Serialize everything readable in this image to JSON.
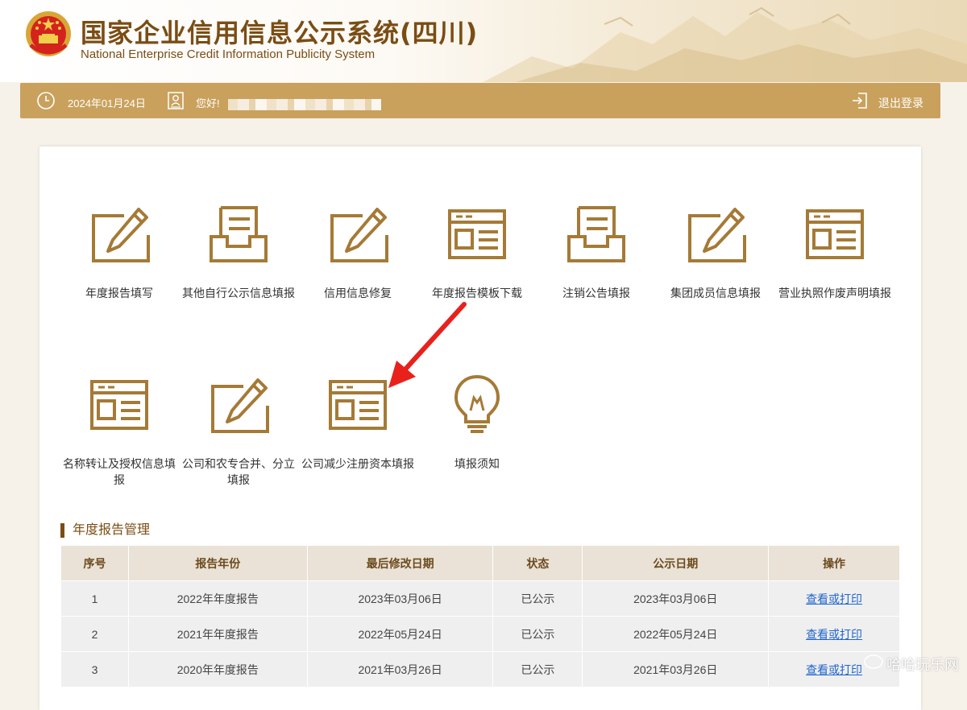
{
  "header": {
    "title": "国家企业信用信息公示系统(四川)",
    "subtitle": "National Enterprise Credit Information Publicity System"
  },
  "userbar": {
    "date": "2024年01月24日",
    "greeting": "您好!",
    "logout": "退出登录"
  },
  "tiles": [
    {
      "label": "年度报告填写",
      "icon": "pencil-edit-icon"
    },
    {
      "label": "其他自行公示信息填报",
      "icon": "document-tray-icon"
    },
    {
      "label": "信用信息修复",
      "icon": "pencil-edit-icon"
    },
    {
      "label": "年度报告模板下载",
      "icon": "form-template-icon"
    },
    {
      "label": "注销公告填报",
      "icon": "document-tray-icon"
    },
    {
      "label": "集团成员信息填报",
      "icon": "pencil-edit-icon"
    },
    {
      "label": "营业执照作废声明填报",
      "icon": "form-template-icon"
    },
    {
      "label": "名称转让及授权信息填报",
      "icon": "form-template-icon"
    },
    {
      "label": "公司和农专合并、分立填报",
      "icon": "pencil-edit-icon"
    },
    {
      "label": "公司减少注册资本填报",
      "icon": "form-template-icon"
    },
    {
      "label": "填报须知",
      "icon": "lightbulb-icon"
    }
  ],
  "reports": {
    "section_title": "年度报告管理",
    "columns": [
      "序号",
      "报告年份",
      "最后修改日期",
      "状态",
      "公示日期",
      "操作"
    ],
    "rows": [
      {
        "no": "1",
        "year": "2022年年度报告",
        "modified": "2023年03月06日",
        "status": "已公示",
        "published": "2023年03月06日",
        "action": "查看或打印"
      },
      {
        "no": "2",
        "year": "2021年年度报告",
        "modified": "2022年05月24日",
        "status": "已公示",
        "published": "2022年05月24日",
        "action": "查看或打印"
      },
      {
        "no": "3",
        "year": "2020年年度报告",
        "modified": "2021年03月26日",
        "status": "已公示",
        "published": "2021年03月26日",
        "action": "查看或打印"
      }
    ]
  },
  "watermark": "哈哈玩乐网",
  "colors": {
    "brand_brown": "#7a4d14",
    "gold_bar": "#c9a15c",
    "icon_gold": "#a57a36",
    "link_blue": "#2166cc",
    "annotation_red": "#e8211d"
  }
}
